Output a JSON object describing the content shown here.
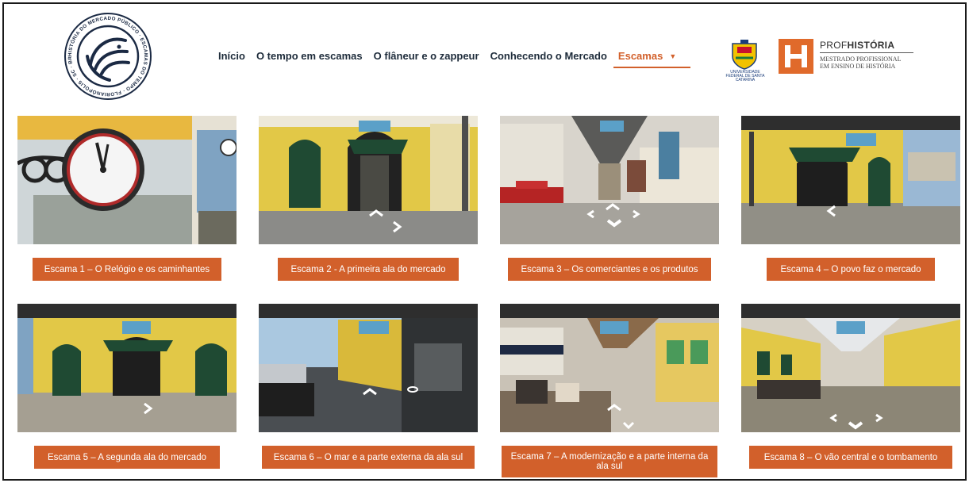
{
  "logo": {
    "ring_text": "HISTÓRIA DO MERCADO PÚBLICO · ESCAMAS DO TEMPO · FLORIANÓPOLIS · SC · BRASIL",
    "icon": "fish-icon"
  },
  "nav": {
    "items": [
      {
        "label": "Início",
        "active": false
      },
      {
        "label": "O tempo em escamas",
        "active": false
      },
      {
        "label": "O flâneur e o zappeur",
        "active": false
      },
      {
        "label": "Conhecendo o Mercado",
        "active": false
      },
      {
        "label": "Escamas",
        "active": true,
        "dropdown": true
      }
    ],
    "dropdown_icon": "caret-down-icon"
  },
  "partners": {
    "ufsc_caption": "UNIVERSIDADE FEDERAL DE SANTA CATARINA",
    "profhistoria_prefix": "PROF",
    "profhistoria_bold": "HISTÓRIA",
    "profhistoria_sub1": "MESTRADO PROFISSIONAL",
    "profhistoria_sub2": "EM ENSINO DE HISTÓRIA",
    "brand_color": "#e06a2b"
  },
  "cards": [
    {
      "label": "Escama 1 – O Relógio e os caminhantes",
      "scene": "clock"
    },
    {
      "label": "Escama 2 - A primeira ala do mercado",
      "scene": "facade-arch"
    },
    {
      "label": "Escama 3 – Os comerciantes e os produtos",
      "scene": "corridor"
    },
    {
      "label": "Escama 4 – O povo faz o mercado",
      "scene": "facade-street"
    },
    {
      "label": "Escama 5 – A segunda ala do mercado",
      "scene": "facade-wide"
    },
    {
      "label": "Escama 6 – O mar e a parte externa da ala sul",
      "scene": "sidewalk"
    },
    {
      "label": "Escama 7 – A modernização e a parte interna da ala sul",
      "scene": "food-court"
    },
    {
      "label": "Escama 8 – O vão central e o tombamento",
      "scene": "central-span"
    }
  ],
  "colors": {
    "accent": "#d2602b",
    "nav_text": "#1d2b3a"
  }
}
